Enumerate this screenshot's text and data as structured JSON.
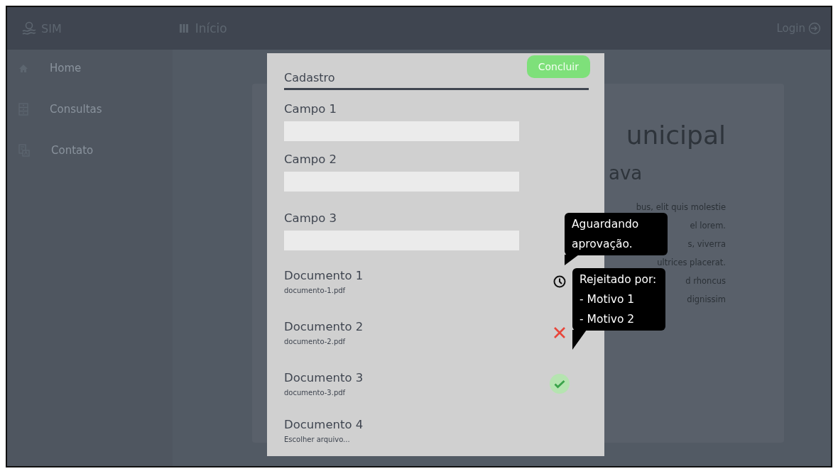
{
  "topbar": {
    "brand": "SIM",
    "nav": "Início",
    "login": "Login"
  },
  "sidebar": {
    "items": [
      {
        "label": "Home"
      },
      {
        "label": "Consultas"
      },
      {
        "label": "Contato"
      }
    ]
  },
  "background_card": {
    "title": "unicipal",
    "subtitle": "ava",
    "lines": [
      "bus, elit quis molestie",
      "el lorem.",
      "s, viverra",
      "ultrices placerat.",
      "d rhoncus",
      "dignissim"
    ]
  },
  "modal": {
    "title": "Cadastro",
    "button": "Concluir",
    "fields": [
      {
        "label": "Campo 1"
      },
      {
        "label": "Campo 2"
      },
      {
        "label": "Campo 3"
      }
    ],
    "documents": [
      {
        "name": "Documento 1",
        "file": "documento-1.pdf",
        "kind": "pending"
      },
      {
        "name": "Documento 2",
        "file": "documento-2.pdf",
        "kind": "rejected"
      },
      {
        "name": "Documento 3",
        "file": "documento-3.pdf",
        "kind": "approved"
      },
      {
        "name": "Documento 4",
        "file": "Escolher arquivo...",
        "kind": "upload"
      }
    ]
  },
  "tooltips": [
    {
      "lines": [
        "Aguardando",
        "aprovação."
      ]
    },
    {
      "lines": [
        "Rejeitado por:",
        "- Motivo 1",
        "- Motivo 2"
      ]
    }
  ]
}
